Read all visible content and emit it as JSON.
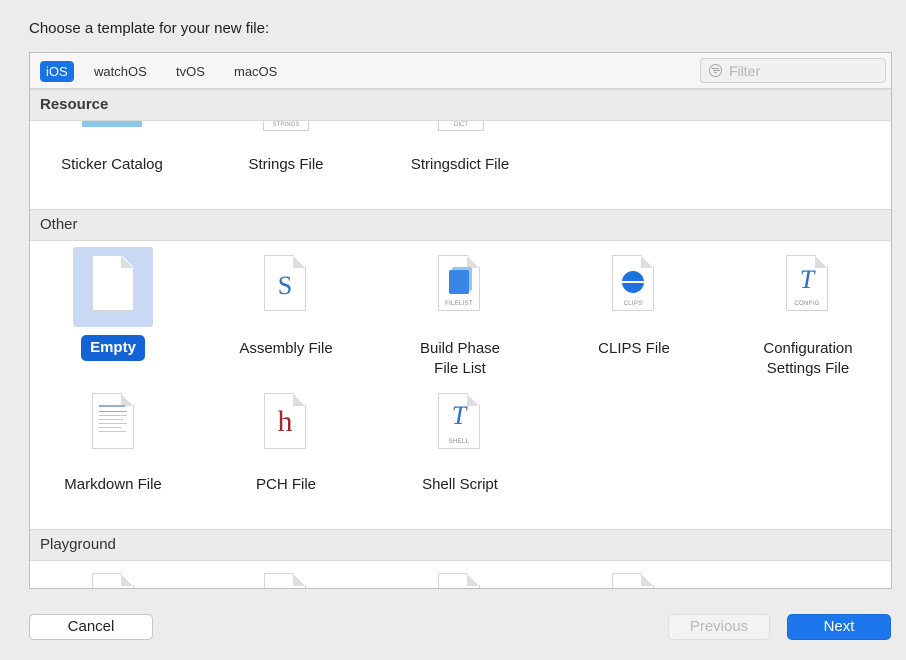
{
  "dialog": {
    "prompt": "Choose a template for your new file:"
  },
  "tabs": [
    {
      "label": "iOS",
      "active": true
    },
    {
      "label": "watchOS",
      "active": false
    },
    {
      "label": "tvOS",
      "active": false
    },
    {
      "label": "macOS",
      "active": false
    }
  ],
  "filter": {
    "placeholder": "Filter",
    "value": ""
  },
  "sections": {
    "resource": {
      "title": "Resource",
      "items": [
        {
          "label": "Sticker Catalog",
          "icon": "sticker-catalog-icon"
        },
        {
          "label": "Strings File",
          "icon": "strings-file-icon",
          "tag": "STRINGS"
        },
        {
          "label": "Stringsdict File",
          "icon": "stringsdict-file-icon",
          "tag": "DICT"
        }
      ]
    },
    "other": {
      "title": "Other",
      "items": [
        {
          "label": "Empty",
          "icon": "empty-file-icon",
          "selected": true
        },
        {
          "label": "Assembly File",
          "icon": "assembly-file-icon",
          "glyph": "S"
        },
        {
          "label": "Build Phase\nFile List",
          "label_line1": "Build Phase",
          "label_line2": "File List",
          "icon": "build-phase-file-list-icon",
          "tag": "FILELIST"
        },
        {
          "label": "CLIPS File",
          "icon": "clips-file-icon",
          "tag": "CLIPS"
        },
        {
          "label_line1": "Configuration",
          "label_line2": "Settings File",
          "icon": "configuration-settings-file-icon",
          "tag": "CONFIG"
        },
        {
          "label": "Markdown File",
          "icon": "markdown-file-icon"
        },
        {
          "label": "PCH File",
          "icon": "pch-file-icon",
          "glyph": "h"
        },
        {
          "label": "Shell Script",
          "icon": "shell-script-icon",
          "tag": "SHELL"
        }
      ]
    },
    "playground": {
      "title": "Playground"
    }
  },
  "buttons": {
    "cancel": "Cancel",
    "previous": "Previous",
    "next": "Next"
  },
  "colors": {
    "accent": "#1a72e8",
    "selection_bg": "#c9d9f4",
    "disabled_text": "#b9b9b9"
  }
}
